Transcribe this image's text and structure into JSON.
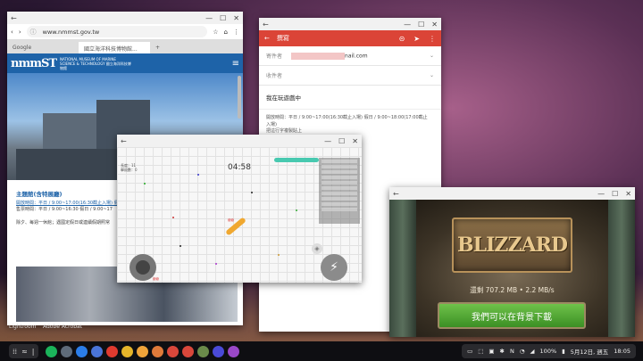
{
  "browser": {
    "url": "www.nmmst.gov.tw",
    "tabs": [
      "Google",
      "國立海洋科技博物館..."
    ],
    "logo": "nmmST",
    "logo_sub": "NATIONAL MUSEUM OF MARINE SCIENCE & TECHNOLOGY 國立海洋科技博物館",
    "section_title": "主題館(含特展廳)",
    "hours_line1": "開放時間：平日 / 9:00~17:00(16:30截止入場) 假日 / 9:00~17:",
    "hours_line2": "售票時間：平日 / 9:00~16:30 假日 / 9:00~17",
    "closed_note": "除夕、每週一休館；遇國定假日或連續假期照常"
  },
  "email": {
    "title": "撰寫",
    "from_label": "寄件者",
    "from_value": "nail.com",
    "to_label": "收件者",
    "subject": "我在玩遊戲中",
    "body_lines": [
      "開放時間：平日 / 9:00~17:00(16:30截止入場) 假日 / 9:00~18:00(17:00截止",
      "入場)",
      "把這行字複製貼上"
    ]
  },
  "game": {
    "timer": "04:58",
    "stats_line1": "長度：11",
    "stats_line2": "擊殺數：0",
    "player_label": "爺爺",
    "player_label2": "爺爺"
  },
  "video": {
    "logo": "BLIZZARD",
    "download_status": "還剩 707.2 MB • 2.2 MB/s",
    "download_button": "我們可以在背景下載"
  },
  "desktop_labels": [
    "Lightroom",
    "Adobe Acrobat"
  ],
  "taskbar": {
    "apps": [
      {
        "name": "play-store-icon",
        "color": "#1bb35a"
      },
      {
        "name": "clock-icon",
        "color": "#5f6b7a"
      },
      {
        "name": "files-icon",
        "color": "#2b7de9"
      },
      {
        "name": "settings-icon",
        "color": "#4a74d8"
      },
      {
        "name": "youtube-icon",
        "color": "#e03a2f"
      },
      {
        "name": "chrome-icon",
        "color": "#e6b52a"
      },
      {
        "name": "photos-icon",
        "color": "#f0a43a"
      },
      {
        "name": "gallery-icon",
        "color": "#e07a3a"
      },
      {
        "name": "gmail-icon",
        "color": "#d9473b"
      },
      {
        "name": "gmail2-icon",
        "color": "#d9473b"
      },
      {
        "name": "game-icon",
        "color": "#6a8a4a"
      },
      {
        "name": "browser-icon",
        "color": "#4a4ad8"
      },
      {
        "name": "store-icon",
        "color": "#9a48c8"
      }
    ],
    "battery": "100%",
    "date": "5月12日, 週五",
    "time": "18:05"
  }
}
